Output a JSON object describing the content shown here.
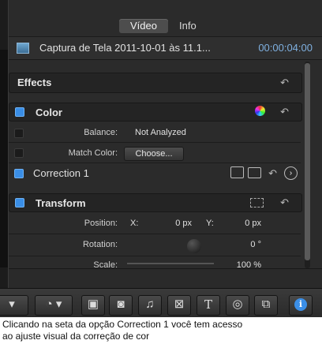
{
  "tabs": [
    "Vídeo",
    "Info"
  ],
  "clip": {
    "title": "Captura de Tela 2011-10-01 às 11.1...",
    "timecode": "00:00:04:00",
    "icon": "image-icon"
  },
  "effects": {
    "label": "Effects",
    "reset": "↶"
  },
  "color": {
    "label": "Color",
    "reset": "↶",
    "add_icon": "color-board-icon",
    "balance_label": "Balance:",
    "balance_value": "Not Analyzed",
    "match_label": "Match Color:",
    "match_button": "Choose...",
    "correction_label": "Correction 1",
    "correction_arrow": "›"
  },
  "transform": {
    "label": "Transform",
    "reset": "↶",
    "position_label": "Position:",
    "x_label": "X:",
    "x_value": "0 px",
    "y_label": "Y:",
    "y_value": "0 px",
    "rotation_label": "Rotation:",
    "rotation_value": "0 °",
    "scale_label": "Scale:",
    "scale_value": "100 %"
  },
  "toolbar": {
    "tools_icon": "select-tool-icon",
    "retime_icon": "retime-icon",
    "browsers": [
      "photos-browser-icon",
      "camera-browser-icon",
      "music-browser-icon",
      "transitions-browser-icon",
      "titles-browser-icon",
      "generators-browser-icon",
      "themes-browser-icon"
    ],
    "info_icon": "inspector-info-icon"
  },
  "caption": {
    "line1": "Clicando na seta da opção Correction 1 você tem acesso",
    "line2": "ao ajuste visual da correção de cor"
  }
}
